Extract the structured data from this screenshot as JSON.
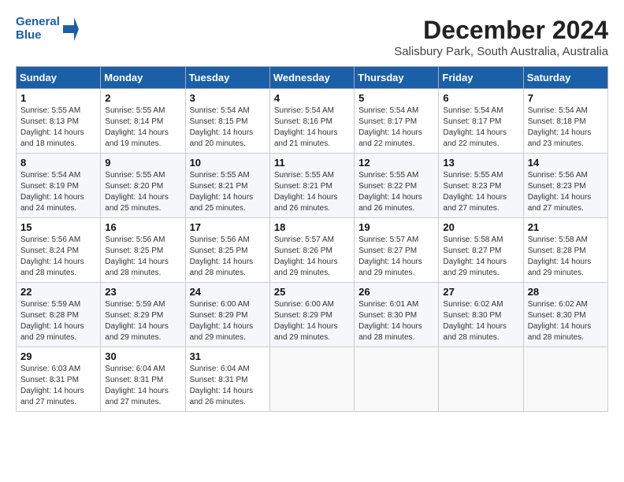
{
  "logo": {
    "line1": "General",
    "line2": "Blue"
  },
  "title": "December 2024",
  "subtitle": "Salisbury Park, South Australia, Australia",
  "days_of_week": [
    "Sunday",
    "Monday",
    "Tuesday",
    "Wednesday",
    "Thursday",
    "Friday",
    "Saturday"
  ],
  "weeks": [
    [
      {
        "day": "1",
        "info": "Sunrise: 5:55 AM\nSunset: 8:13 PM\nDaylight: 14 hours\nand 18 minutes."
      },
      {
        "day": "2",
        "info": "Sunrise: 5:55 AM\nSunset: 8:14 PM\nDaylight: 14 hours\nand 19 minutes."
      },
      {
        "day": "3",
        "info": "Sunrise: 5:54 AM\nSunset: 8:15 PM\nDaylight: 14 hours\nand 20 minutes."
      },
      {
        "day": "4",
        "info": "Sunrise: 5:54 AM\nSunset: 8:16 PM\nDaylight: 14 hours\nand 21 minutes."
      },
      {
        "day": "5",
        "info": "Sunrise: 5:54 AM\nSunset: 8:17 PM\nDaylight: 14 hours\nand 22 minutes."
      },
      {
        "day": "6",
        "info": "Sunrise: 5:54 AM\nSunset: 8:17 PM\nDaylight: 14 hours\nand 22 minutes."
      },
      {
        "day": "7",
        "info": "Sunrise: 5:54 AM\nSunset: 8:18 PM\nDaylight: 14 hours\nand 23 minutes."
      }
    ],
    [
      {
        "day": "8",
        "info": "Sunrise: 5:54 AM\nSunset: 8:19 PM\nDaylight: 14 hours\nand 24 minutes."
      },
      {
        "day": "9",
        "info": "Sunrise: 5:55 AM\nSunset: 8:20 PM\nDaylight: 14 hours\nand 25 minutes."
      },
      {
        "day": "10",
        "info": "Sunrise: 5:55 AM\nSunset: 8:21 PM\nDaylight: 14 hours\nand 25 minutes."
      },
      {
        "day": "11",
        "info": "Sunrise: 5:55 AM\nSunset: 8:21 PM\nDaylight: 14 hours\nand 26 minutes."
      },
      {
        "day": "12",
        "info": "Sunrise: 5:55 AM\nSunset: 8:22 PM\nDaylight: 14 hours\nand 26 minutes."
      },
      {
        "day": "13",
        "info": "Sunrise: 5:55 AM\nSunset: 8:23 PM\nDaylight: 14 hours\nand 27 minutes."
      },
      {
        "day": "14",
        "info": "Sunrise: 5:56 AM\nSunset: 8:23 PM\nDaylight: 14 hours\nand 27 minutes."
      }
    ],
    [
      {
        "day": "15",
        "info": "Sunrise: 5:56 AM\nSunset: 8:24 PM\nDaylight: 14 hours\nand 28 minutes."
      },
      {
        "day": "16",
        "info": "Sunrise: 5:56 AM\nSunset: 8:25 PM\nDaylight: 14 hours\nand 28 minutes."
      },
      {
        "day": "17",
        "info": "Sunrise: 5:56 AM\nSunset: 8:25 PM\nDaylight: 14 hours\nand 28 minutes."
      },
      {
        "day": "18",
        "info": "Sunrise: 5:57 AM\nSunset: 8:26 PM\nDaylight: 14 hours\nand 29 minutes."
      },
      {
        "day": "19",
        "info": "Sunrise: 5:57 AM\nSunset: 8:27 PM\nDaylight: 14 hours\nand 29 minutes."
      },
      {
        "day": "20",
        "info": "Sunrise: 5:58 AM\nSunset: 8:27 PM\nDaylight: 14 hours\nand 29 minutes."
      },
      {
        "day": "21",
        "info": "Sunrise: 5:58 AM\nSunset: 8:28 PM\nDaylight: 14 hours\nand 29 minutes."
      }
    ],
    [
      {
        "day": "22",
        "info": "Sunrise: 5:59 AM\nSunset: 8:28 PM\nDaylight: 14 hours\nand 29 minutes."
      },
      {
        "day": "23",
        "info": "Sunrise: 5:59 AM\nSunset: 8:29 PM\nDaylight: 14 hours\nand 29 minutes."
      },
      {
        "day": "24",
        "info": "Sunrise: 6:00 AM\nSunset: 8:29 PM\nDaylight: 14 hours\nand 29 minutes."
      },
      {
        "day": "25",
        "info": "Sunrise: 6:00 AM\nSunset: 8:29 PM\nDaylight: 14 hours\nand 29 minutes."
      },
      {
        "day": "26",
        "info": "Sunrise: 6:01 AM\nSunset: 8:30 PM\nDaylight: 14 hours\nand 28 minutes."
      },
      {
        "day": "27",
        "info": "Sunrise: 6:02 AM\nSunset: 8:30 PM\nDaylight: 14 hours\nand 28 minutes."
      },
      {
        "day": "28",
        "info": "Sunrise: 6:02 AM\nSunset: 8:30 PM\nDaylight: 14 hours\nand 28 minutes."
      }
    ],
    [
      {
        "day": "29",
        "info": "Sunrise: 6:03 AM\nSunset: 8:31 PM\nDaylight: 14 hours\nand 27 minutes."
      },
      {
        "day": "30",
        "info": "Sunrise: 6:04 AM\nSunset: 8:31 PM\nDaylight: 14 hours\nand 27 minutes."
      },
      {
        "day": "31",
        "info": "Sunrise: 6:04 AM\nSunset: 8:31 PM\nDaylight: 14 hours\nand 26 minutes."
      },
      {
        "day": "",
        "info": ""
      },
      {
        "day": "",
        "info": ""
      },
      {
        "day": "",
        "info": ""
      },
      {
        "day": "",
        "info": ""
      }
    ]
  ]
}
